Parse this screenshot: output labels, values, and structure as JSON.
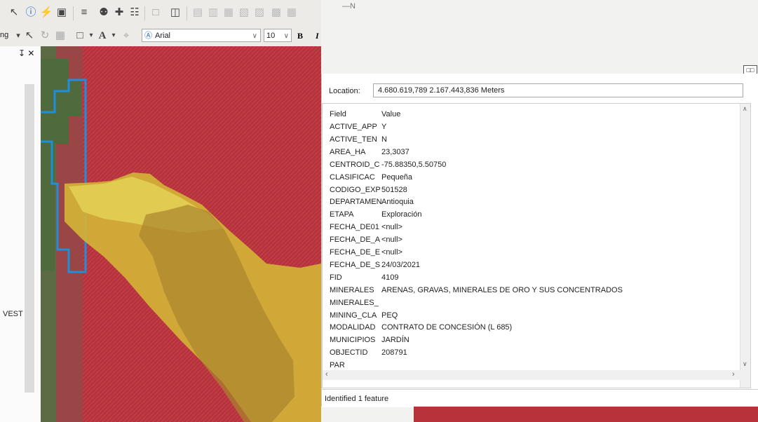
{
  "toolbar": {
    "font_name": "Arial",
    "font_size": "10",
    "bold_label": "B",
    "italic_label": "I",
    "font_color_label": "A",
    "dropdown_text": "ng"
  },
  "panel": {
    "pin_label": "↧ ✕",
    "side_text": "VEST"
  },
  "map": {
    "north_label": "—N"
  },
  "identify": {
    "location_label": "Location:",
    "location_value": "4.680.619,789  2.167.443,836 Meters",
    "field_header": "Field",
    "value_header": "Value",
    "rows": [
      {
        "field": "ACTIVE_APP",
        "value": "Y"
      },
      {
        "field": "ACTIVE_TEN",
        "value": "N"
      },
      {
        "field": "AREA_HA",
        "value": "23,3037"
      },
      {
        "field": "CENTROID_C",
        "value": "-75.88350,5.50750"
      },
      {
        "field": "CLASIFICAC",
        "value": "Pequeña"
      },
      {
        "field": "CODIGO_EXP",
        "value": "501528"
      },
      {
        "field": "DEPARTAMEN",
        "value": "Antioquia"
      },
      {
        "field": "ETAPA",
        "value": "Exploración"
      },
      {
        "field": "FECHA_DE01",
        "value": "<null>"
      },
      {
        "field": "FECHA_DE_A",
        "value": "<null>"
      },
      {
        "field": "FECHA_DE_E",
        "value": "<null>"
      },
      {
        "field": "FECHA_DE_S",
        "value": "24/03/2021"
      },
      {
        "field": "FID",
        "value": "4109"
      },
      {
        "field": "MINERALES",
        "value": "ARENAS, GRAVAS, MINERALES DE ORO Y SUS CONCENTRADOS"
      },
      {
        "field": "MINERALES_",
        "value": ""
      },
      {
        "field": "MINING_CLA",
        "value": "PEQ"
      },
      {
        "field": "MODALIDAD",
        "value": "CONTRATO DE CONCESIÓN (L 685)"
      },
      {
        "field": "MUNICIPIOS",
        "value": "JARDÍN"
      },
      {
        "field": "OBJECTID",
        "value": "208791"
      },
      {
        "field": "PAR",
        "value": ""
      }
    ],
    "status": "Identified 1 feature"
  },
  "colors": {
    "polygon_red": "#b8323c",
    "polygon_yellow": "#d4b536",
    "boundary_blue": "#1f8fd8"
  }
}
